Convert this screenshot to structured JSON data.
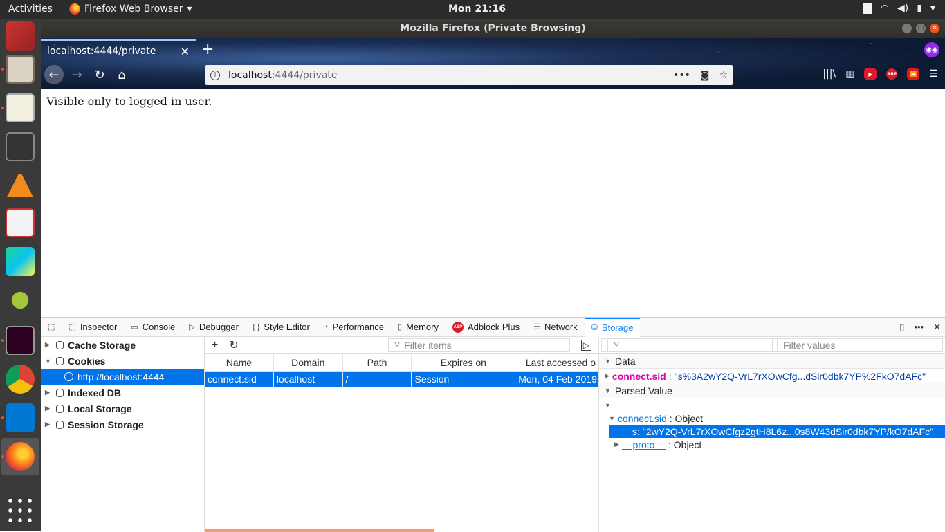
{
  "topbar": {
    "activities": "Activities",
    "app_name": "Firefox Web Browser",
    "clock": "Mon 21:16"
  },
  "window": {
    "title": "Mozilla Firefox (Private Browsing)"
  },
  "browser": {
    "tab_title": "localhost:4444/private",
    "url_host": "localhost",
    "url_path": ":4444/private",
    "abp_label": "ABP"
  },
  "page": {
    "text": "Visible only to logged in user."
  },
  "devtools": {
    "tabs": [
      "Inspector",
      "Console",
      "Debugger",
      "Style Editor",
      "Performance",
      "Memory",
      "Adblock Plus",
      "Network",
      "Storage"
    ],
    "tree": {
      "cache_storage": "Cache Storage",
      "cookies": "Cookies",
      "cookies_host": "http://localhost:4444",
      "indexed_db": "Indexed DB",
      "local_storage": "Local Storage",
      "session_storage": "Session Storage"
    },
    "filter_items_placeholder": "Filter items",
    "filter_values_placeholder": "Filter values",
    "columns": [
      "Name",
      "Domain",
      "Path",
      "Expires on",
      "Last accessed o"
    ],
    "row": {
      "name": "connect.sid",
      "domain": "localhost",
      "path": "/",
      "expires": "Session",
      "last_accessed": "Mon, 04 Feb 2019"
    },
    "sidebar": {
      "data_header": "Data",
      "data_key": "connect.sid",
      "data_value": "\"s%3A2wY2Q-VrL7rXOwCfg...dSir0dbk7YP%2FkO7dAFc\"",
      "parsed_header": "Parsed Value",
      "parsed_key": "connect.sid",
      "parsed_type": ": Object",
      "s_line": "s: \"2wY2Q-VrL7rXOwCfgz2gtH8L6z...0s8W43dSir0dbk7YP/kO7dAFc\"",
      "proto": "__proto__",
      "proto_type": ": Object"
    }
  }
}
